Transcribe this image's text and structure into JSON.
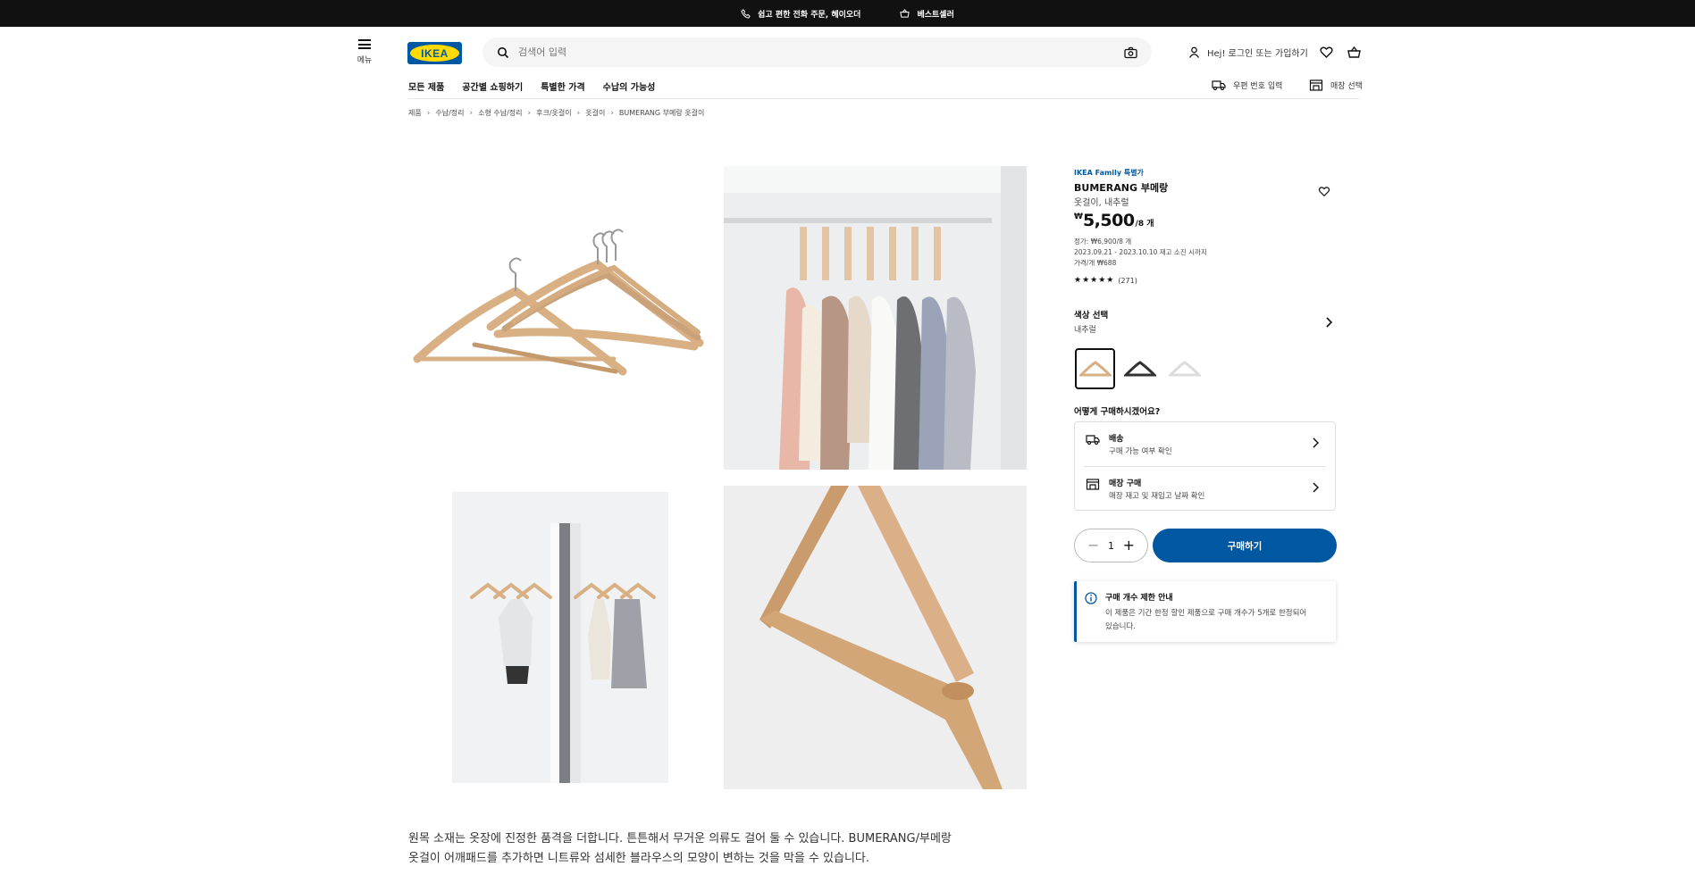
{
  "promo": {
    "call_text": "쉽고 편한 전화 주문, 헤이오더",
    "bestseller_text": "베스트셀러"
  },
  "header": {
    "menu_label": "메뉴",
    "logo_text": "IKEA",
    "search_placeholder": "검색어 입력",
    "account_text": "Hej! 로그인 또는 가입하기"
  },
  "nav": {
    "items": [
      "모든 제품",
      "공간별 쇼핑하기",
      "특별한 가격",
      "수납의 가능성"
    ],
    "zip_label": "우편 번호 입력",
    "store_label": "매장 선택"
  },
  "breadcrumb": [
    "제품",
    "수납/정리",
    "소형 수납/정리",
    "후크/옷걸이",
    "옷걸이",
    "BUMERANG 부메랑 옷걸이"
  ],
  "product": {
    "family_label": "IKEA Family 특별가",
    "name": "BUMERANG 부메랑",
    "description": "옷걸이, 내추럴",
    "currency": "₩",
    "price": "5,500",
    "unit": "/8 개",
    "regular_price": "정가: ₩6,900/8 개",
    "period": "2023.09.21 - 2023.10.10 재고 소진 시까지",
    "unit_price": "가격/개 ₩688",
    "stars": "★★★★★",
    "review_count": "(271)",
    "rating_value": 4.6
  },
  "color": {
    "title": "색상 선택",
    "value": "내추럴"
  },
  "purchase": {
    "title": "어떻게 구매하시겠어요?",
    "delivery_title": "배송",
    "delivery_sub": "구매 가능 여부 확인",
    "store_title": "매장 구매",
    "store_sub": "매장 재고 및 재입고 날짜 확인"
  },
  "cart": {
    "quantity": "1",
    "buy_label": "구매하기"
  },
  "notice": {
    "title": "구매 개수 제한 안내",
    "body": "이 제품은 기간 한정 할인 제품으로 구매 개수가 5개로 한정되어 있습니다."
  },
  "description_text": "원목 소재는 옷장에 진정한 품격을 더합니다. 튼튼해서 무거운 의류도 걸어 둘 수 있습니다. BUMERANG/부메랑 옷걸이 어깨패드를 추가하면 니트류와 섬세한 블라우스의 모양이 변하는 것을 막을 수 있습니다.",
  "colors": {
    "brand_blue": "#0058a3",
    "brand_yellow": "#ffdb00",
    "wood": "#d9b083"
  },
  "icons": [
    "phone-icon",
    "basket-icon",
    "hamburger-icon",
    "search-icon",
    "camera-icon",
    "user-icon",
    "heart-icon",
    "cart-icon",
    "truck-icon",
    "store-icon",
    "chevron-right-icon",
    "info-icon"
  ]
}
